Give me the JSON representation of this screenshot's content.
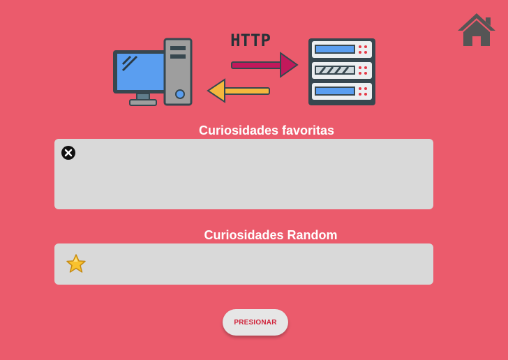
{
  "illustration": {
    "protocol_label": "HTTP"
  },
  "favorites": {
    "title": "Curiosidades favoritas"
  },
  "random": {
    "title": "Curiosidades Random"
  },
  "press_button": {
    "label": "PRESIONAR"
  },
  "icons": {
    "home": "home-icon",
    "close": "close-circle-icon",
    "star": "star-icon"
  },
  "colors": {
    "background": "#eb5b6c",
    "panel": "#d9d9d9",
    "button_text": "#d0243b",
    "title_text": "#ffffff"
  }
}
